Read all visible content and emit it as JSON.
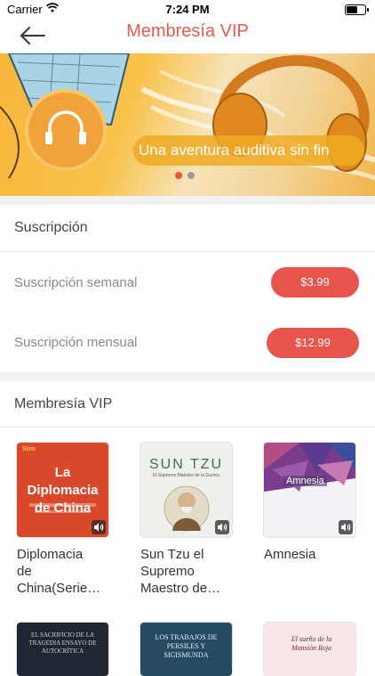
{
  "status": {
    "carrier": "Carrier",
    "time": "7:24 PM"
  },
  "nav": {
    "title": "Membresía VIP"
  },
  "banner": {
    "text": "Una aventura auditiva sin fin"
  },
  "subscription": {
    "heading": "Suscripción",
    "weekly_label": "Suscripción semanal",
    "weekly_price": "$3.99",
    "monthly_label": "Suscripción mensual",
    "monthly_price": "$12.99"
  },
  "vip": {
    "heading": "Membresía VIP",
    "books": [
      {
        "title_lines": [
          "Diplomacia",
          "de",
          "China(Serie…"
        ],
        "cover_text": "La Diplomacia de China",
        "cover_brand": "Sino"
      },
      {
        "title_lines": [
          "Sun Tzu el",
          "Supremo",
          "Maestro de…"
        ],
        "cover_text": "SUN TZU",
        "cover_sub": "El Supremo Maestro de la Guerra"
      },
      {
        "title_lines": [
          "Amnesia"
        ],
        "cover_text": "Amnesia"
      }
    ],
    "row2": [
      {
        "cover_text": "EL SACRIFICIO DE LA TRAGEDIA ENSAYO DE AUTOCRÍTICA"
      },
      {
        "cover_text": "LOS TRABAJOS DE PERSILES Y SIGISMUNDA"
      },
      {
        "cover_text": "El sueño de la Mansión Roja"
      }
    ]
  },
  "colors": {
    "accent": "#e8534c",
    "title": "#e8594f"
  }
}
